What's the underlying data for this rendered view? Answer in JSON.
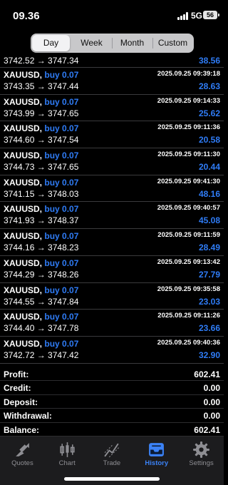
{
  "status_bar": {
    "time": "09.36",
    "network": "5G",
    "battery": "56"
  },
  "period_tabs": [
    {
      "label": "Day",
      "active": true
    },
    {
      "label": "Week",
      "active": false
    },
    {
      "label": "Month",
      "active": false
    },
    {
      "label": "Custom",
      "active": false
    }
  ],
  "first_row": {
    "prices": "3742.52 → 3747.34",
    "profit": "38.56"
  },
  "deals": [
    {
      "symbol": "XAUUSD,",
      "type": "buy 0.07",
      "time": "2025.09.25 09:39:18",
      "prices": "3743.35 → 3747.44",
      "profit": "28.63"
    },
    {
      "symbol": "XAUUSD,",
      "type": "buy 0.07",
      "time": "2025.09.25 09:14:33",
      "prices": "3743.99 → 3747.65",
      "profit": "25.62"
    },
    {
      "symbol": "XAUUSD,",
      "type": "buy 0.07",
      "time": "2025.09.25 09:11:36",
      "prices": "3744.60 → 3747.54",
      "profit": "20.58"
    },
    {
      "symbol": "XAUUSD,",
      "type": "buy 0.07",
      "time": "2025.09.25 09:11:30",
      "prices": "3744.73 → 3747.65",
      "profit": "20.44"
    },
    {
      "symbol": "XAUUSD,",
      "type": "buy 0.07",
      "time": "2025.09.25 09:41:30",
      "prices": "3741.15 → 3748.03",
      "profit": "48.16"
    },
    {
      "symbol": "XAUUSD,",
      "type": "buy 0.07",
      "time": "2025.09.25 09:40:57",
      "prices": "3741.93 → 3748.37",
      "profit": "45.08"
    },
    {
      "symbol": "XAUUSD,",
      "type": "buy 0.07",
      "time": "2025.09.25 09:11:59",
      "prices": "3744.16 → 3748.23",
      "profit": "28.49"
    },
    {
      "symbol": "XAUUSD,",
      "type": "buy 0.07",
      "time": "2025.09.25 09:13:42",
      "prices": "3744.29 → 3748.26",
      "profit": "27.79"
    },
    {
      "symbol": "XAUUSD,",
      "type": "buy 0.07",
      "time": "2025.09.25 09:35:58",
      "prices": "3744.55 → 3747.84",
      "profit": "23.03"
    },
    {
      "symbol": "XAUUSD,",
      "type": "buy 0.07",
      "time": "2025.09.25 09:11:26",
      "prices": "3744.40 → 3747.78",
      "profit": "23.66"
    },
    {
      "symbol": "XAUUSD,",
      "type": "buy 0.07",
      "time": "2025.09.25 09:40:36",
      "prices": "3742.72 → 3747.42",
      "profit": "32.90"
    }
  ],
  "summary": [
    {
      "label": "Profit:",
      "value": "602.41"
    },
    {
      "label": "Credit:",
      "value": "0.00"
    },
    {
      "label": "Deposit:",
      "value": "0.00"
    },
    {
      "label": "Withdrawal:",
      "value": "0.00"
    },
    {
      "label": "Balance:",
      "value": "602.41"
    }
  ],
  "tab_bar": [
    {
      "label": "Quotes",
      "icon": "quotes-icon",
      "active": false
    },
    {
      "label": "Chart",
      "icon": "candlestick-chart-icon",
      "active": false
    },
    {
      "label": "Trade",
      "icon": "trade-line-icon",
      "active": false
    },
    {
      "label": "History",
      "icon": "inbox-tray-icon",
      "active": true
    },
    {
      "label": "Settings",
      "icon": "gear-icon",
      "active": false
    }
  ],
  "colors": {
    "accent": "#2f7cf6",
    "background": "#000000",
    "tab_bar": "#1c1c1e",
    "inactive_tab": "#8e8e93"
  }
}
